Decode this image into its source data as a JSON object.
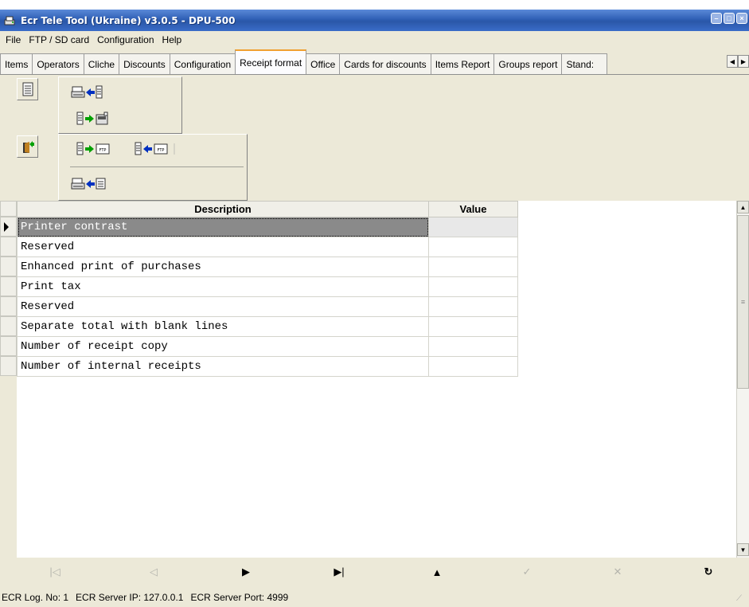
{
  "window": {
    "title": "Ecr Tele Tool (Ukraine) v3.0.5  -  DPU-500"
  },
  "menu": [
    "File",
    "FTP / SD card",
    "Configuration",
    "Help"
  ],
  "tabs": [
    "Items",
    "Operators",
    "Cliche",
    "Discounts",
    "Configuration",
    "Receipt format",
    "Office",
    "Cards for discounts",
    "Items Report",
    "Groups report",
    "Stand:"
  ],
  "active_tab": "Receipt format",
  "toolbar": {
    "icons": [
      "document-icon",
      "printer-read-icon",
      "file-to-device-icon",
      "exit-icon",
      "file-to-ftp-icon",
      "ftp-to-file-icon",
      "printer-image-icon"
    ]
  },
  "grid": {
    "columns": {
      "description": "Description",
      "value": "Value"
    },
    "rows": [
      {
        "description": "Printer contrast",
        "value": ""
      },
      {
        "description": "Reserved",
        "value": ""
      },
      {
        "description": "Enhanced print of purchases",
        "value": ""
      },
      {
        "description": "Print tax",
        "value": ""
      },
      {
        "description": "Reserved",
        "value": ""
      },
      {
        "description": "Separate total with blank lines",
        "value": ""
      },
      {
        "description": "Number of receipt copy",
        "value": ""
      },
      {
        "description": "Number of internal receipts",
        "value": ""
      }
    ]
  },
  "navigator": [
    "first-record-icon",
    "prior-record-icon",
    "next-record-icon",
    "last-record-icon",
    "insert-record-icon",
    "post-edit-icon",
    "cancel-edit-icon",
    "refresh-icon"
  ],
  "status": {
    "log_no": "ECR Log. No: 1",
    "server_ip": "ECR Server IP: 127.0.0.1",
    "server_port": "ECR Server Port: 4999"
  },
  "colors": {
    "title_bar": "#2f5fb5",
    "active_tab_accent": "#f0a030",
    "selected_row": "#8a8a8a"
  }
}
